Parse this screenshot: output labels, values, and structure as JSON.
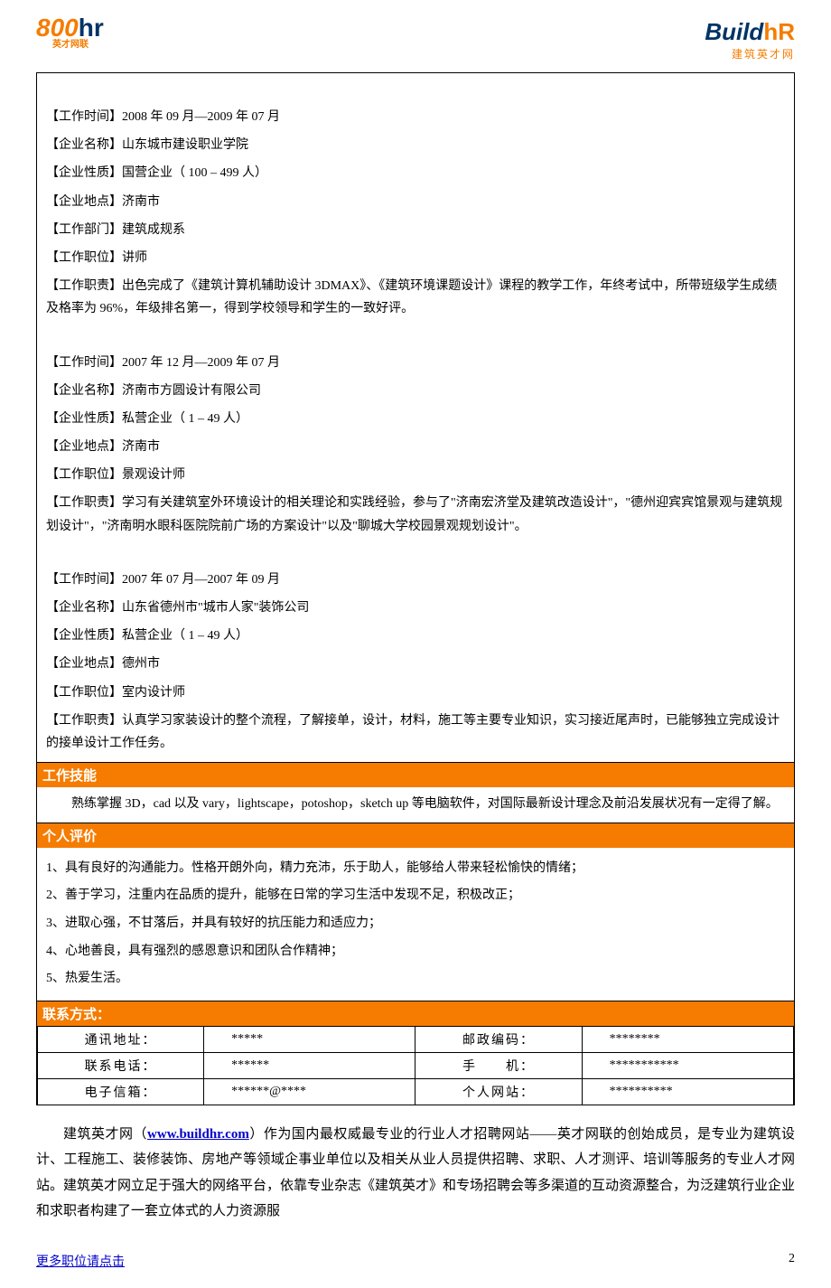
{
  "logos": {
    "left_main": "800",
    "left_hr": "hr",
    "left_sub": "英才网联",
    "right_build": "Build",
    "right_hr": "hR",
    "right_sub": "建筑英才网"
  },
  "jobs": [
    {
      "time_label": "【工作时间】",
      "time_value": "2008 年 09 月—2009 年 07 月",
      "company_label": "【企业名称】",
      "company_value": "山东城市建设职业学院",
      "nature_label": "【企业性质】",
      "nature_value": "国营企业（ 100 – 499 人）",
      "location_label": "【企业地点】",
      "location_value": "济南市",
      "dept_label": "【工作部门】",
      "dept_value": "建筑成规系",
      "position_label": "【工作职位】",
      "position_value": "讲师",
      "duty_label": "【工作职责】",
      "duty_value": "出色完成了《建筑计算机辅助设计 3DMAX》、《建筑环境课题设计》课程的教学工作，年终考试中，所带班级学生成绩及格率为 96%，年级排名第一，得到学校领导和学生的一致好评。"
    },
    {
      "time_label": "【工作时间】",
      "time_value": "2007 年 12 月—2009 年 07 月",
      "company_label": "【企业名称】",
      "company_value": "济南市方圆设计有限公司",
      "nature_label": "【企业性质】",
      "nature_value": "私营企业（ 1 – 49 人）",
      "location_label": "【企业地点】",
      "location_value": "济南市",
      "dept_label": "",
      "dept_value": "",
      "position_label": "【工作职位】",
      "position_value": "景观设计师",
      "duty_label": "【工作职责】",
      "duty_value": "学习有关建筑室外环境设计的相关理论和实践经验，参与了\"济南宏济堂及建筑改造设计\"，\"德州迎宾宾馆景观与建筑规划设计\"，\"济南明水眼科医院院前广场的方案设计\"以及\"聊城大学校园景观规划设计\"。"
    },
    {
      "time_label": "【工作时间】",
      "time_value": "2007 年 07 月—2007 年 09 月",
      "company_label": "【企业名称】",
      "company_value": "山东省德州市\"城市人家\"装饰公司",
      "nature_label": "【企业性质】",
      "nature_value": "私营企业（ 1 – 49 人）",
      "location_label": "【企业地点】",
      "location_value": "德州市",
      "dept_label": "",
      "dept_value": "",
      "position_label": "【工作职位】",
      "position_value": "室内设计师",
      "duty_label": "【工作职责】",
      "duty_value": "认真学习家装设计的整个流程，了解接单，设计，材料，施工等主要专业知识，实习接近尾声时，已能够独立完成设计的接单设计工作任务。"
    }
  ],
  "sections": {
    "skills_header": "工作技能",
    "skills_body": "熟练掌握 3D，cad 以及 vary，lightscape，potoshop，sketch up 等电脑软件，对国际最新设计理念及前沿发展状况有一定得了解。",
    "eval_header": "个人评价",
    "eval_lines": [
      "1、具有良好的沟通能力。性格开朗外向，精力充沛，乐于助人，能够给人带来轻松愉快的情绪；",
      "2、善于学习，注重内在品质的提升，能够在日常的学习生活中发现不足，积极改正；",
      "3、进取心强，不甘落后，并具有较好的抗压能力和适应力；",
      "4、心地善良，具有强烈的感恩意识和团队合作精神；",
      "5、热爱生活。"
    ],
    "contact_header": "联系方式："
  },
  "contact": {
    "rows": [
      {
        "l1": "通讯地址：",
        "v1": "*****",
        "l2": "邮政编码：",
        "v2": "********"
      },
      {
        "l1": "联系电话：",
        "v1": "******",
        "l2": "手　　机：",
        "v2": "***********"
      },
      {
        "l1": "电子信箱：",
        "v1": "******@****",
        "l2": "个人网站：",
        "v2": "**********"
      }
    ]
  },
  "footer": {
    "lead": "建筑英才网（",
    "link": "www.buildhr.com",
    "rest": "）作为国内最权威最专业的行业人才招聘网站——英才网联的创始成员，是专业为建筑设计、工程施工、装修装饰、房地产等领域企事业单位以及相关从业人员提供招聘、求职、人才测评、培训等服务的专业人才网站。建筑英才网立足于强大的网络平台，依靠专业杂志《建筑英才》和专场招聘会等多渠道的互动资源整合，为泛建筑行业企业和求职者构建了一套立体式的人力资源服"
  },
  "bottom": {
    "more": "更多职位请点击",
    "page": "2"
  }
}
